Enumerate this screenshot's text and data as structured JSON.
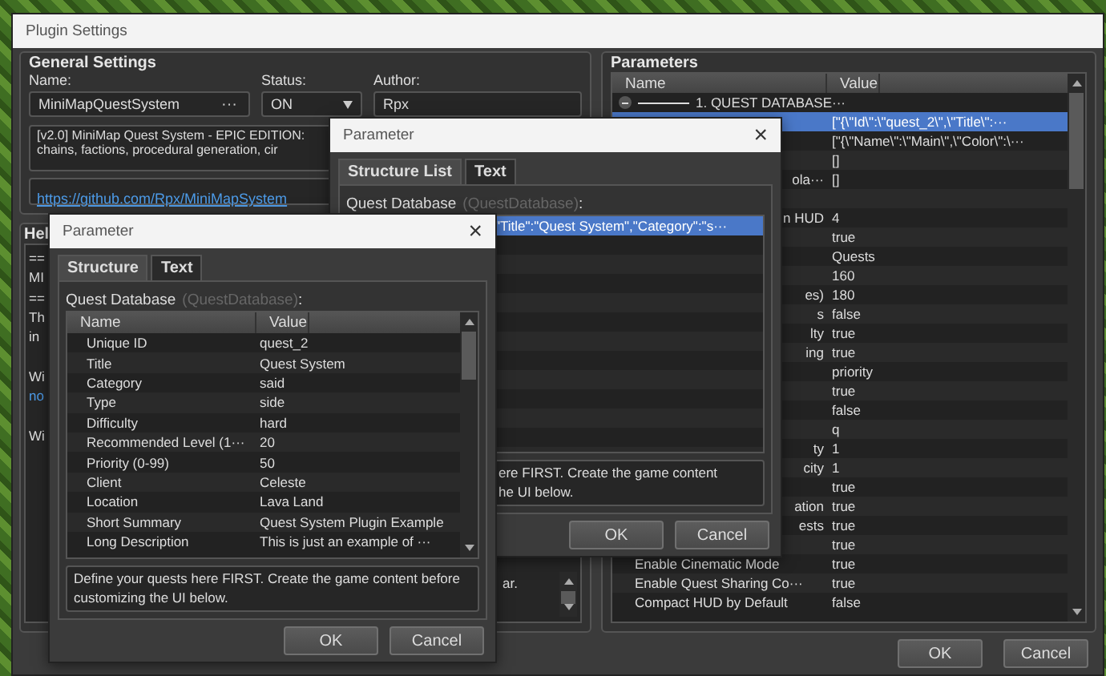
{
  "window": {
    "title": "Plugin Settings",
    "general_settings": {
      "heading": "General Settings",
      "name_label": "Name:",
      "name_value": "MiniMapQuestSystem",
      "name_button": "···",
      "status_label": "Status:",
      "status_value": "ON",
      "author_label": "Author:",
      "author_value": "Rpx",
      "description_lines": [
        "[v2.0] MiniMap Quest System - EPIC EDITION:",
        "chains, factions, procedural generation, cir"
      ],
      "link": "https://github.com/Rpx/MiniMapSystem"
    },
    "help": {
      "heading": "Hel",
      "lines": [
        {
          "kind": "text",
          "text": "=="
        },
        {
          "kind": "text",
          "text": "MI"
        },
        {
          "kind": "text",
          "text": "=="
        },
        {
          "kind": "text",
          "text": "Th"
        },
        {
          "kind": "text",
          "text": "in"
        },
        {
          "kind": "blank"
        },
        {
          "kind": "text",
          "text": "Wi"
        },
        {
          "kind": "link",
          "text": "no"
        },
        {
          "kind": "blank"
        },
        {
          "kind": "text",
          "text": "Wi"
        }
      ],
      "fragment": "ar."
    },
    "parameters": {
      "heading": "Parameters",
      "columns": [
        "Name",
        "Value"
      ],
      "rows": [
        {
          "kind": "group",
          "name": "1. QUEST DATABASE···",
          "selected": false
        },
        {
          "kind": "param",
          "value": "[\"{\\\"Id\\\":\\\"quest_2\\\",\\\"Title\\\":···",
          "selected": true
        },
        {
          "kind": "param",
          "value": "[\"{\\\"Name\\\":\\\"Main\\\",\\\"Color\\\":\\···",
          "selected": false
        },
        {
          "kind": "param",
          "value": "[]",
          "selected": false
        },
        {
          "kind": "clipped",
          "name": "ola···",
          "value": "[]",
          "selected": false
        },
        {
          "kind": "param",
          "selected": false
        },
        {
          "kind": "clipped",
          "name": "n HUD",
          "value": "4",
          "selected": false
        },
        {
          "kind": "param",
          "value": "true",
          "selected": false
        },
        {
          "kind": "param",
          "value": "Quests",
          "selected": false
        },
        {
          "kind": "param",
          "value": "160",
          "selected": false
        },
        {
          "kind": "clipped",
          "name": "es)",
          "value": "180",
          "selected": false
        },
        {
          "kind": "clipped",
          "name": "s",
          "value": "false",
          "selected": false
        },
        {
          "kind": "clipped",
          "name": "lty",
          "value": "true",
          "selected": false
        },
        {
          "kind": "clipped",
          "name": "ing",
          "value": "true",
          "selected": false
        },
        {
          "kind": "param",
          "value": "priority",
          "selected": false
        },
        {
          "kind": "param",
          "value": "true",
          "selected": false
        },
        {
          "kind": "param",
          "value": "false",
          "selected": false
        },
        {
          "kind": "param",
          "value": "q",
          "selected": false
        },
        {
          "kind": "clipped",
          "name": "ty",
          "value": "1",
          "selected": false
        },
        {
          "kind": "clipped",
          "name": "city",
          "value": "1",
          "selected": false
        },
        {
          "kind": "param",
          "value": "true",
          "selected": false
        },
        {
          "kind": "clipped",
          "name": "ation",
          "value": "true",
          "selected": false
        },
        {
          "kind": "clipped",
          "name": "ests",
          "value": "true",
          "selected": false
        },
        {
          "kind": "param",
          "value": "true",
          "selected": false
        },
        {
          "kind": "param",
          "name": "Enable Cinematic Mode",
          "value": "true",
          "selected": false
        },
        {
          "kind": "param",
          "name": "Enable Quest Sharing Co···",
          "value": "true",
          "selected": false
        },
        {
          "kind": "param",
          "name": "Compact HUD by Default",
          "value": "false",
          "selected": false
        }
      ]
    },
    "buttons": [
      "OK",
      "Cancel"
    ]
  },
  "dialogs": [
    {
      "kind": "list",
      "title": "Parameter",
      "close": "×",
      "tabs": [
        {
          "label": "Structure List",
          "selected": true
        },
        {
          "label": "Text",
          "selected": false
        }
      ],
      "field_label": "Quest Database",
      "field_key": "(QuestDatabase)",
      "field_suffix": ":",
      "rows": [
        {
          "text": "\"Title\":\"Quest System\",\"Category\":\"s···",
          "selected": true
        }
      ],
      "description_lines": [
        "ere FIRST. Create the game content",
        "he UI below."
      ],
      "buttons": [
        "OK",
        "Cancel"
      ]
    },
    {
      "kind": "table",
      "title": "Parameter",
      "close": "×",
      "tabs": [
        {
          "label": "Structure",
          "selected": true
        },
        {
          "label": "Text",
          "selected": false
        }
      ],
      "field_label": "Quest Database",
      "field_key": "(QuestDatabase)",
      "field_suffix": ":",
      "columns": [
        "Name",
        "Value"
      ],
      "rows": [
        {
          "name": "Unique ID",
          "value": "quest_2"
        },
        {
          "name": "Title",
          "value": "Quest System"
        },
        {
          "name": "Category",
          "value": "said"
        },
        {
          "name": "Type",
          "value": "side"
        },
        {
          "name": "Difficulty",
          "value": "hard"
        },
        {
          "name": "Recommended Level (1···",
          "value": "20"
        },
        {
          "name": "Priority (0-99)",
          "value": "50"
        },
        {
          "name": "Client",
          "value": "Celeste"
        },
        {
          "name": "Location",
          "value": "Lava Land"
        },
        {
          "name": "Short Summary",
          "value": "Quest System Plugin Example"
        },
        {
          "name": "Long Description",
          "value": "This is just an example of ···"
        }
      ],
      "description_lines": [
        "Define your quests here FIRST. Create the game content before customizing the UI below."
      ],
      "buttons": [
        "OK",
        "Cancel"
      ]
    }
  ]
}
